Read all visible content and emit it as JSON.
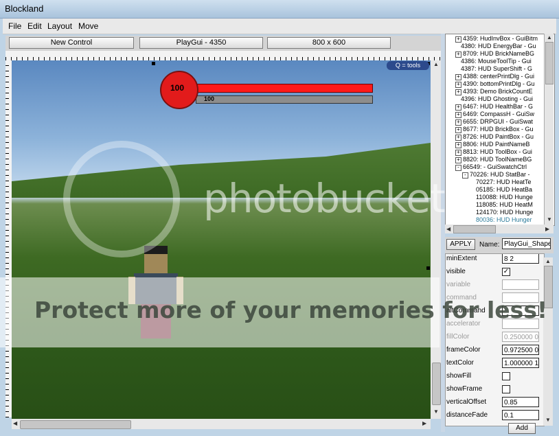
{
  "window": {
    "title": "Blockland"
  },
  "menu": [
    "File",
    "Edit",
    "Layout",
    "Move"
  ],
  "toolbar": {
    "new_control": "New Control",
    "gui_name": "PlayGui - 4350",
    "resolution": "800 x 600"
  },
  "hud": {
    "health_value": "100",
    "stamina_value": "100",
    "tools_hint": "Q = tools",
    "colors": {
      "health": "#e21b1b"
    }
  },
  "tree": {
    "items": [
      {
        "label": "4359: HudInvBox - GuiBitm",
        "exp": "+"
      },
      {
        "label": "4380: HUD  EnergyBar - Gu",
        "exp": ""
      },
      {
        "label": "8709: HUD  BrickNameBG",
        "exp": "+"
      },
      {
        "label": "4386: MouseToolTip - Gui",
        "exp": ""
      },
      {
        "label": "4387: HUD  SuperShift - G",
        "exp": ""
      },
      {
        "label": "4388: centerPrintDlg - Gui",
        "exp": "+"
      },
      {
        "label": "4390: bottomPrintDlg - Gu",
        "exp": "+"
      },
      {
        "label": "4393: Demo  BrickCountE",
        "exp": "+"
      },
      {
        "label": "4396: HUD  Ghosting - Gui",
        "exp": ""
      },
      {
        "label": "6467: HUD  HealthBar - G",
        "exp": "+"
      },
      {
        "label": "6469: CompassH - GuiSw",
        "exp": "+"
      },
      {
        "label": "6655: DRPGUI - GuiSwat",
        "exp": "+"
      },
      {
        "label": "8677: HUD  BrickBox - Gu",
        "exp": "+"
      },
      {
        "label": "8726: HUD  PaintBox - Gu",
        "exp": "+"
      },
      {
        "label": "8806: HUD  PaintNameB",
        "exp": "+"
      },
      {
        "label": "8813: HUD  ToolBox - Gui",
        "exp": "+"
      },
      {
        "label": "8820: HUD  ToolNameBG",
        "exp": "+"
      },
      {
        "label": "66549:  - GuiSwatchCtrl",
        "exp": "-"
      },
      {
        "label": "70226: HUD  StatBar -",
        "exp": "-"
      },
      {
        "label": "70227: HUD  HeatTe",
        "exp": ""
      },
      {
        "label": "05185: HUD  HeatBa",
        "exp": ""
      },
      {
        "label": "110088: HUD  Hunge",
        "exp": ""
      },
      {
        "label": "118085: HUD  HeatM",
        "exp": ""
      },
      {
        "label": "124170: HUD  Hunge",
        "exp": ""
      },
      {
        "label": "80036: HUD  Hunger",
        "exp": ""
      }
    ]
  },
  "inspector": {
    "apply_label": "APPLY",
    "name_label": "Name:",
    "name_value": "PlayGui_Shape",
    "properties": [
      {
        "name": "minExtent",
        "value": "8 2",
        "kind": "text",
        "dim": false
      },
      {
        "name": "visible",
        "value": "✓",
        "kind": "check",
        "dim": false
      },
      {
        "name": "variable",
        "value": "",
        "kind": "text",
        "dim": true
      },
      {
        "name": "command",
        "value": "",
        "kind": "text",
        "dim": true
      },
      {
        "name": "altCommand",
        "value": "",
        "kind": "text",
        "dim": false
      },
      {
        "name": "accelerator",
        "value": "",
        "kind": "text",
        "dim": true
      },
      {
        "name": "fillColor",
        "value": "0.250000 0",
        "kind": "text",
        "dim": true
      },
      {
        "name": "frameColor",
        "value": "0.972500 0",
        "kind": "text",
        "dim": false
      },
      {
        "name": "textColor",
        "value": "1.000000 1",
        "kind": "text",
        "dim": false
      },
      {
        "name": "showFill",
        "value": "",
        "kind": "check",
        "dim": false
      },
      {
        "name": "showFrame",
        "value": "",
        "kind": "check",
        "dim": false
      },
      {
        "name": "verticalOffset",
        "value": "0.85",
        "kind": "text",
        "dim": false
      },
      {
        "name": "distanceFade",
        "value": "0.1",
        "kind": "text",
        "dim": false
      }
    ],
    "add_label": "Add"
  },
  "watermark": {
    "logo_text": "photobucket",
    "banner_text": "Protect more of your memories for less!"
  }
}
